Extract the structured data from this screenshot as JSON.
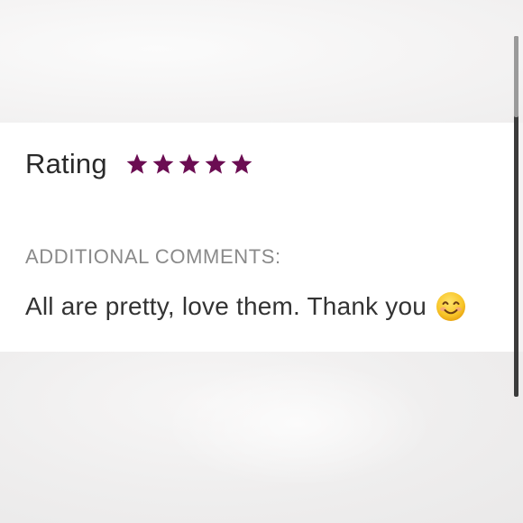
{
  "review": {
    "rating_label": "Rating",
    "rating": {
      "value": 5,
      "max": 5
    },
    "star_color": "#6b0d52",
    "comments_heading": "ADDITIONAL COMMENTS:",
    "comment_text": "All are pretty, love them. Thank you",
    "emoji": "smiling-face-icon"
  }
}
